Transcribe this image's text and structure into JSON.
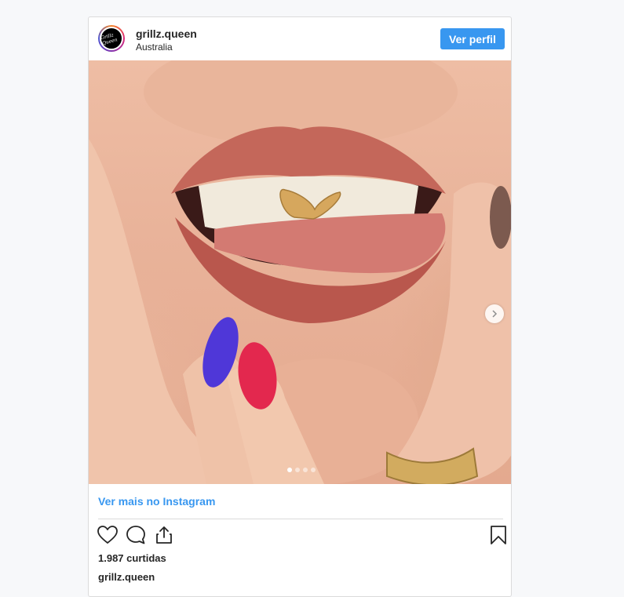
{
  "post": {
    "username": "grillz.queen",
    "location": "Australia",
    "avatar_text": "Grillz Queen",
    "profile_button_label": "Ver perfil",
    "view_more_link": "Ver mais no Instagram",
    "likes": "1.987 curtidas",
    "caption_user": "grillz.queen",
    "carousel": {
      "total": 4,
      "current": 1
    }
  },
  "icons": {
    "like": "heart-icon",
    "comment": "comment-icon",
    "share": "share-icon",
    "save": "bookmark-icon",
    "next": "chevron-right-icon"
  },
  "colors": {
    "accent": "#3897f0",
    "text": "#262626",
    "border": "#dbdbdb"
  }
}
